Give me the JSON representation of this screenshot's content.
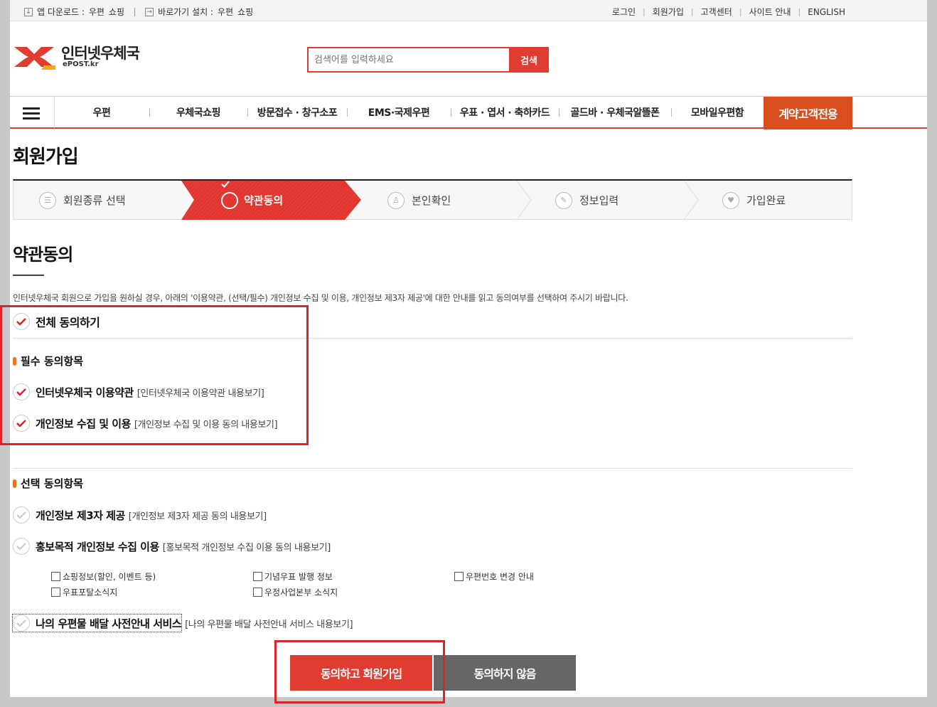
{
  "colors": {
    "accent": "#e03c31",
    "special_bg": "#d94e1f",
    "check_red": "#e0222a",
    "dot_orange": "#e57423",
    "deny_bg": "#666666"
  },
  "topbar": {
    "app_download_label": "앱 다운로드 :",
    "app_links": [
      "우편",
      "쇼핑"
    ],
    "shortcut_label": "바로가기 설치 :",
    "shortcut_links": [
      "우편",
      "쇼핑"
    ],
    "right_links": [
      "로그인",
      "회원가입",
      "고객센터",
      "사이트 안내",
      "ENGLISH"
    ]
  },
  "header": {
    "logo_text": "인터넷우체국",
    "logo_sub": "ePOST.kr",
    "search_placeholder": "검색어를 입력하세요",
    "search_button": "검색"
  },
  "gnb": {
    "items": [
      "우편",
      "우체국쇼핑",
      "방문접수 · 창구소포",
      "EMS·국제우편",
      "우표 · 엽서 · 축하카드",
      "골드바 · 우체국알뜰폰",
      "모바일우편함"
    ],
    "special": "계약고객전용"
  },
  "page_title": "회원가입",
  "steps": [
    "회원종류 선택",
    "약관동의",
    "본인확인",
    "정보입력",
    "가입완료"
  ],
  "active_step": 1,
  "section": {
    "title": "약관동의",
    "intro": "인터넷우체국 회원으로 가입을 원하실 경우, 아래의 '이용약관, (선택/필수) 개인정보 수집 및 이용, 개인정보 제3자 제공'에 대한 안내를 읽고 동의여부를 선택하여 주시기 바랍니다.",
    "agree_all": "전체 동의하기",
    "required_head": "필수 동의항목",
    "required": [
      {
        "title": "인터넷우체국 이용약관",
        "link": "[인터넷우체국 이용약관 내용보기]",
        "checked": true
      },
      {
        "title": "개인정보 수집 및 이용",
        "link": "[개인정보 수집 및 이용 동의 내용보기]",
        "checked": true
      }
    ],
    "optional_head": "선택 동의항목",
    "optional": [
      {
        "title": "개인정보 제3자 제공",
        "link": "[개인정보 제3자 제공 동의 내용보기]",
        "checked": false
      },
      {
        "title": "홍보목적 개인정보 수집 이용",
        "link": "[홍보목적 개인정보 수집 이용 동의 내용보기]",
        "checked": false
      }
    ],
    "promo_options": [
      "쇼핑정보(할인, 이벤트 등)",
      "기념우표 발행 정보",
      "우편번호 변경 안내",
      "우표포탈소식지",
      "우정사업본부 소식지"
    ],
    "delivery": {
      "title": "나의 우편물 배달 사전안내 서비스",
      "link": "[나의 우편물 배달 사전안내 서비스 내용보기]"
    }
  },
  "buttons": {
    "agree_join": "동의하고 회원가입",
    "disagree": "동의하지 않음"
  }
}
